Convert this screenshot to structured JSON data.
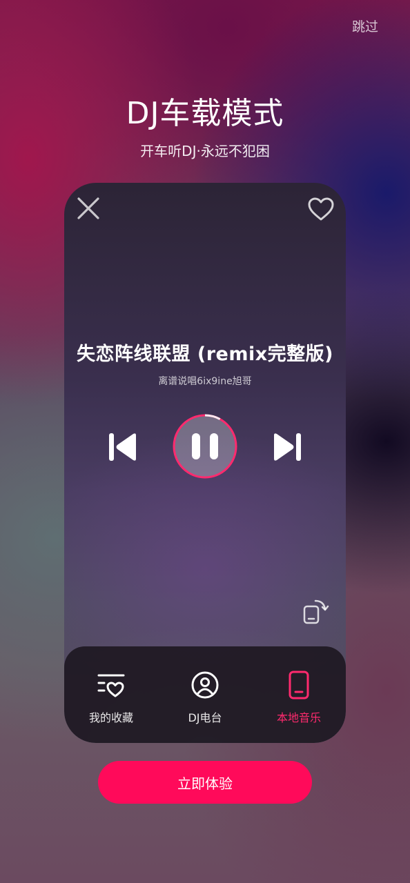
{
  "header": {
    "skip_label": "跳过"
  },
  "intro": {
    "title": "DJ车载模式",
    "subtitle": "开车听DJ·永远不犯困"
  },
  "player": {
    "song_title": "失恋阵线联盟 (remix完整版)",
    "artist": "离谱说唱6ix9ine旭哥",
    "progress": 0.08,
    "state": "playing"
  },
  "bottom_tabs": [
    {
      "label": "我的收藏",
      "icon": "favorites-list-icon",
      "active": false
    },
    {
      "label": "DJ电台",
      "icon": "radio-icon",
      "active": false
    },
    {
      "label": "本地音乐",
      "icon": "phone-icon",
      "active": true
    }
  ],
  "cta": {
    "label": "立即体验"
  },
  "colors": {
    "accent": "#ff0a5a",
    "active_tab": "#ff2a6e"
  }
}
